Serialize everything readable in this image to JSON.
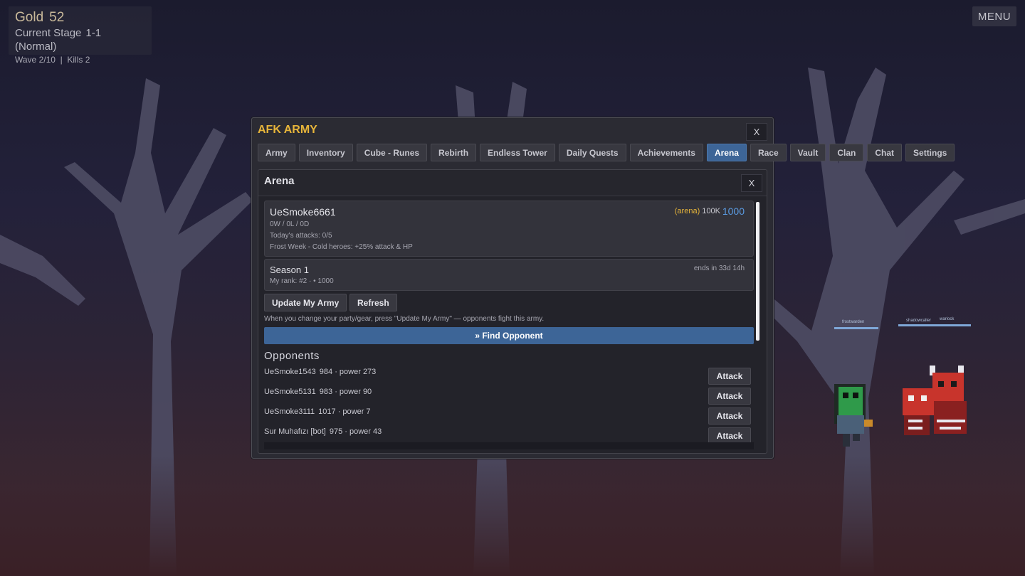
{
  "hud": {
    "gold_label": "Gold",
    "gold_value": "52",
    "stage_label": "Current Stage",
    "stage_value": "1-1 (Normal)",
    "wave_text": "Wave 2/10  |  Kills 2"
  },
  "menu_label": "MENU",
  "window": {
    "title": "AFK ARMY",
    "close": "X",
    "tabs": [
      "Army",
      "Inventory",
      "Cube - Runes",
      "Rebirth",
      "Endless Tower",
      "Daily Quests",
      "Achievements",
      "Arena",
      "Race",
      "Vault",
      "Clan",
      "Chat",
      "Settings"
    ],
    "active_tab": "Arena"
  },
  "arena": {
    "title": "Arena",
    "close": "X",
    "player": {
      "name": "UeSmoke6661",
      "record": "0W / 0L / 0D",
      "attacks": "Today's attacks: 0/5",
      "event": "Frost Week - Cold heroes: +25% attack & HP",
      "arena_label": "(arena)",
      "arena_power": "100K",
      "rating": "1000"
    },
    "season": {
      "name": "Season 1",
      "rank": "My rank: #2 · • 1000",
      "ends": "ends in 33d 14h"
    },
    "update_button": "Update My Army",
    "refresh_button": "Refresh",
    "hint": "When you change your party/gear, press \"Update My Army\" — opponents fight this army.",
    "find_button": "» Find Opponent",
    "opponents_title": "Opponents",
    "opponents": [
      {
        "name": "UeSmoke1543",
        "rating": "984",
        "power": "· power 273",
        "action": "Attack"
      },
      {
        "name": "UeSmoke5131",
        "rating": "983",
        "power": "· power 90",
        "action": "Attack"
      },
      {
        "name": "UeSmoke3111",
        "rating": "1017",
        "power": "· power 7",
        "action": "Attack"
      },
      {
        "name": "Sur Muhafızı [bot]",
        "rating": "975",
        "power": "· power 43",
        "action": "Attack"
      }
    ]
  },
  "field": {
    "name_tags": [
      "frostwarden",
      "shadowcaller",
      "warlock"
    ]
  }
}
